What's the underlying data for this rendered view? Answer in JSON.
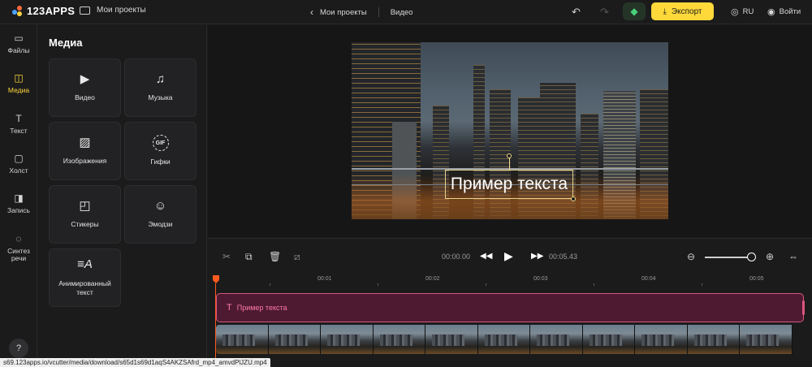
{
  "header": {
    "logo_text": "123APPS",
    "projects_label": "Мои проекты",
    "breadcrumb": [
      "Мои проекты",
      "Видео"
    ],
    "export_label": "Экспорт",
    "lang_label": "RU",
    "login_label": "Войти",
    "icons": {
      "back": "chevron-left-icon",
      "undo": "undo-icon",
      "redo": "redo-icon",
      "premium": "diamond-icon",
      "export": "download-icon",
      "lang": "globe-icon",
      "login": "user-icon"
    }
  },
  "leftnav": {
    "items": [
      {
        "label": "Файлы",
        "icon": "folder-icon"
      },
      {
        "label": "Медиа",
        "icon": "media-icon",
        "active": true
      },
      {
        "label": "Текст",
        "icon": "text-icon"
      },
      {
        "label": "Холст",
        "icon": "canvas-icon"
      },
      {
        "label": "Запись",
        "icon": "record-icon"
      },
      {
        "label": "Синтез речи",
        "icon": "speech-icon"
      }
    ],
    "help_icon": "help-chat-icon"
  },
  "media_panel": {
    "title": "Медиа",
    "tiles": [
      {
        "label": "Видео",
        "icon": "video-icon"
      },
      {
        "label": "Музыка",
        "icon": "music-icon"
      },
      {
        "label": "Изображения",
        "icon": "image-icon"
      },
      {
        "label": "Гифки",
        "icon": "gif-icon",
        "icon_text": "GIF"
      },
      {
        "label": "Стикеры",
        "icon": "sticker-icon"
      },
      {
        "label": "Эмодзи",
        "icon": "emoji-icon"
      },
      {
        "label": "Анимированный текст",
        "icon": "animated-text-icon"
      }
    ]
  },
  "preview": {
    "overlay_text": "Пример текста"
  },
  "toolbar": {
    "current_time": "00:00.00",
    "total_time": "00:05.43",
    "zoom_level": 0.88,
    "icons": [
      "cut-icon",
      "duplicate-icon",
      "delete-icon",
      "fade-icon",
      "rewind-icon",
      "play-icon",
      "forward-icon",
      "zoom-out-icon",
      "zoom-in-icon",
      "fit-icon"
    ]
  },
  "timeline": {
    "ruler": [
      "00:01",
      "00:02",
      "00:03",
      "00:04",
      "00:05"
    ],
    "text_clip_label": "Пример текста",
    "frame_count": 11
  },
  "status_bar": {
    "url": "s69.123apps.io/vcutter/media/download/s65d1s69d1aqS4AKZSAfrd_mp4_amvdPlJZU.mp4"
  }
}
